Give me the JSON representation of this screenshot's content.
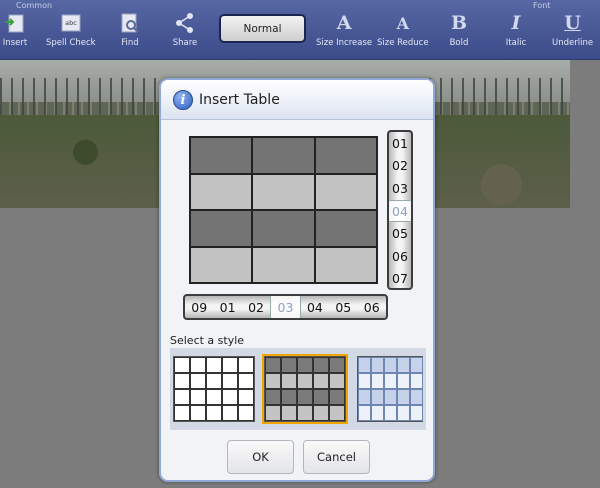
{
  "toolbar": {
    "group_common": "Common",
    "group_font": "Font",
    "insert": "Insert",
    "spell_check": "Spell Check",
    "find": "Find",
    "share": "Share",
    "style_value": "Normal",
    "size_increase": "Size Increase",
    "size_reduce": "Size Reduce",
    "bold": "Bold",
    "italic": "Italic",
    "underline": "Underline"
  },
  "icons": {
    "info": "info-icon",
    "bold_glyph": "B",
    "italic_glyph": "I",
    "underline_glyph": "U",
    "size_increase_glyph": "A",
    "size_reduce_glyph": "A",
    "info_glyph": "i",
    "spell_glyph": "abc"
  },
  "dialog": {
    "title": "Insert Table",
    "rows_picker": [
      "01",
      "02",
      "03",
      "04",
      "05",
      "06",
      "07"
    ],
    "rows_selected": "04",
    "cols_picker": [
      "09",
      "01",
      "02",
      "03",
      "04",
      "05",
      "06"
    ],
    "cols_selected": "03",
    "select_style_label": "Select a style",
    "ok": "OK",
    "cancel": "Cancel"
  },
  "colors": {
    "toolbar": "#4a5a99",
    "accent_selected": "#f0a500",
    "dialog_border": "#8fa8d6"
  }
}
